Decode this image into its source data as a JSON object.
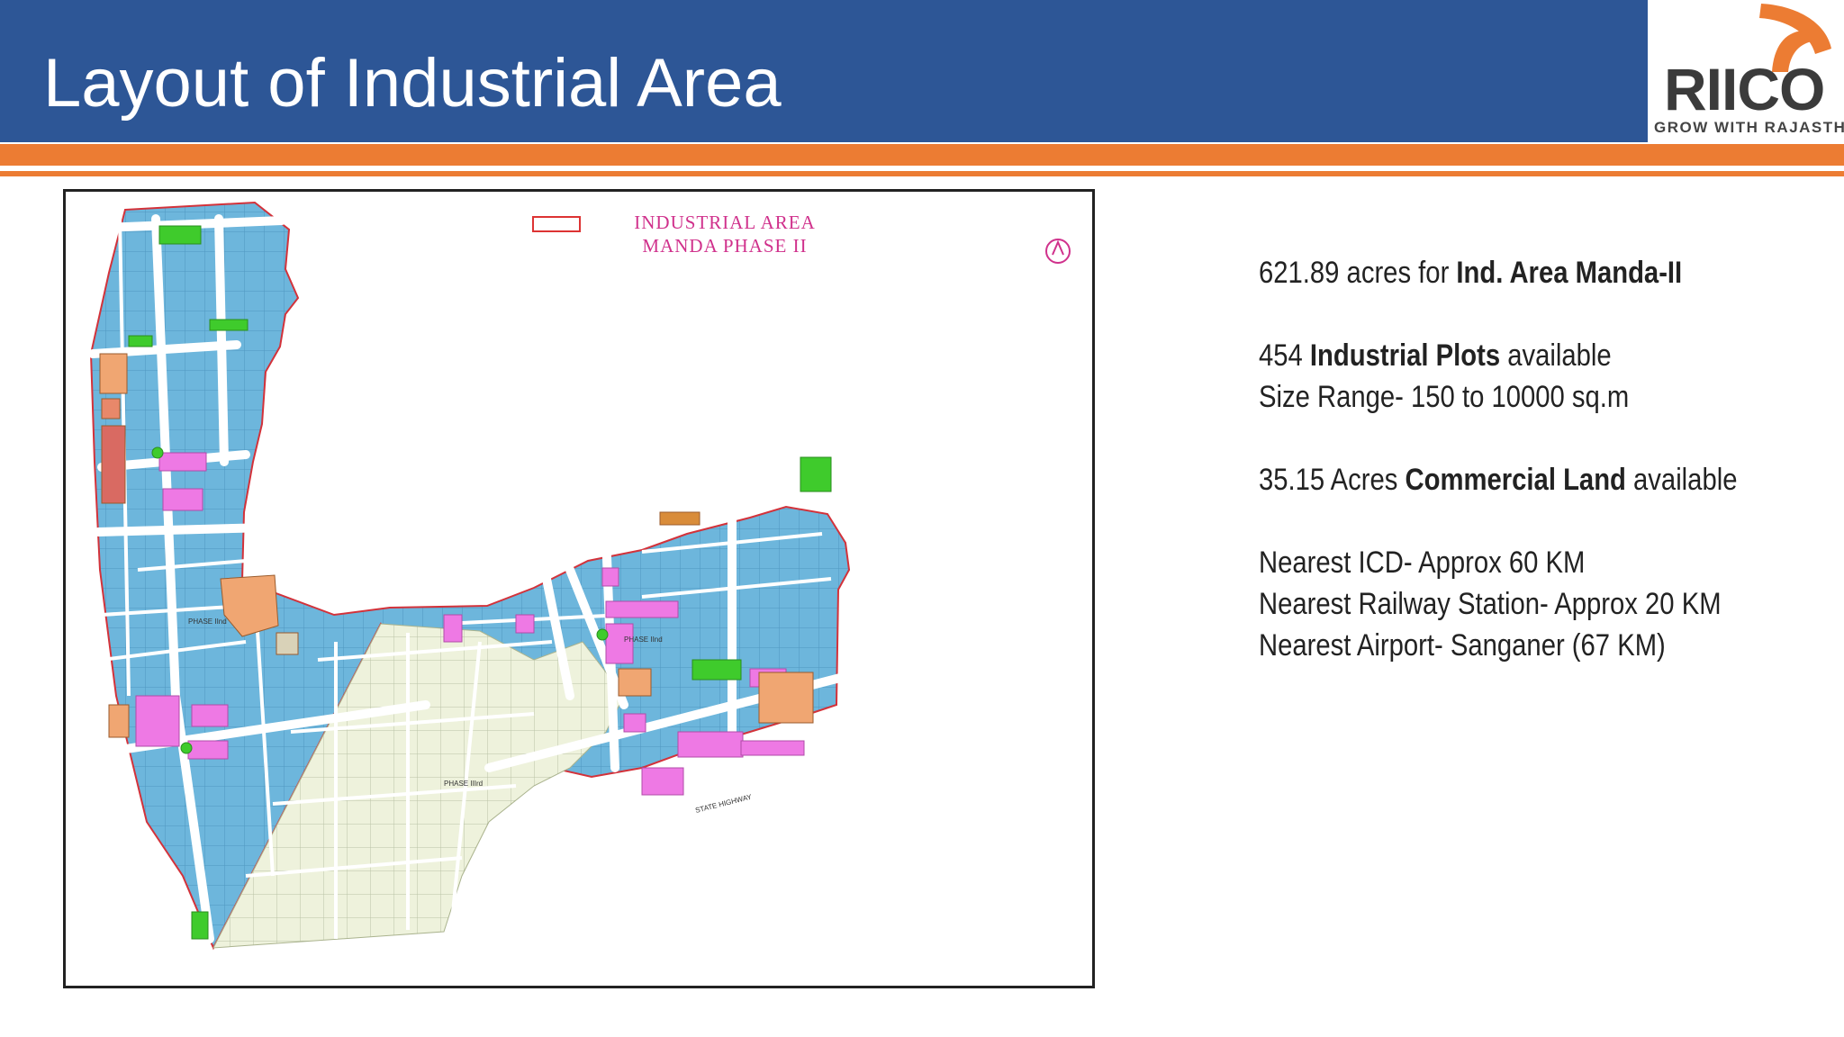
{
  "slide": {
    "title": "Layout of Industrial Area",
    "colors": {
      "header_bg": "#2d5696",
      "accent": "#ec7c33"
    }
  },
  "logo": {
    "name": "RIICO",
    "tagline": "GROW WITH RAJASTHAN"
  },
  "map": {
    "caption_line1": "INDUSTRIAL AREA",
    "caption_line2": "MANDA PHASE II",
    "phase_labels": [
      "PHASE IInd",
      "PHASE IInd",
      "PHASE IIIrd",
      "PHASE III"
    ],
    "road_labels": [
      "STATE HIGHWAY"
    ],
    "colors": {
      "industrial": "#6db6dc",
      "commercial": "#ee79e4",
      "green": "#3fcb2c",
      "facilities": "#f0a672",
      "phase_iii": "#eef2dc",
      "boundary": "#d3323a"
    }
  },
  "info": {
    "area_prefix": "621.89 acres for ",
    "area_bold": "Ind. Area Manda-II",
    "plots_prefix": "454 ",
    "plots_bold": "Industrial Plots",
    "plots_suffix": " available",
    "size_range": "Size Range- 150 to 10000 sq.m",
    "commercial_prefix": "35.15 Acres ",
    "commercial_bold": "Commercial Land",
    "commercial_suffix": " available",
    "nearest_icd": "Nearest ICD-  Approx 60 KM",
    "nearest_railway": "Nearest Railway Station-  Approx 20 KM",
    "nearest_airport": "Nearest Airport-  Sanganer (67 KM)"
  }
}
